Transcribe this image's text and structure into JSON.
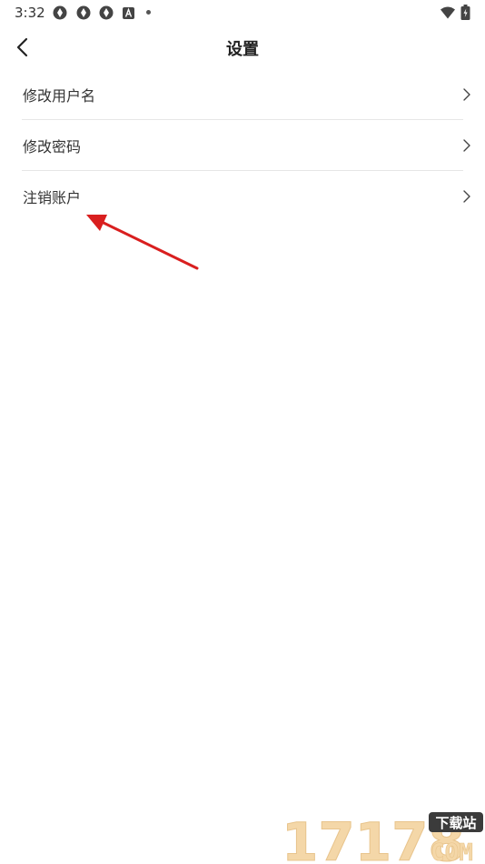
{
  "status_bar": {
    "time": "3:32",
    "left_icons": [
      "app-icon",
      "app-icon",
      "app-icon",
      "a-icon"
    ],
    "right_icons": [
      "wifi-icon",
      "battery-icon"
    ]
  },
  "header": {
    "title": "设置",
    "back_icon": "chevron-left-icon"
  },
  "settings": {
    "items": [
      {
        "label": "修改用户名"
      },
      {
        "label": "修改密码"
      },
      {
        "label": "注销账户"
      }
    ]
  },
  "annotation": {
    "color": "#d91f1f"
  },
  "watermark": {
    "text": "17178",
    "sub": "下载站",
    "domain": "COM",
    "colors": {
      "digits": "#f4d7a8",
      "badge": "#3b3b3b"
    }
  }
}
